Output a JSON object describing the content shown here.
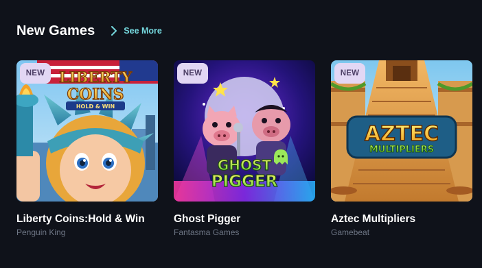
{
  "section": {
    "title": "New Games",
    "see_more": "See More",
    "see_more_icon": "chevron-right-icon"
  },
  "colors": {
    "background": "#0f121a",
    "accent": "#74d6dc",
    "badge_bg": "#e2d7f4",
    "badge_text": "#4d3f66",
    "provider_text": "#6e7685"
  },
  "games": [
    {
      "badge": "NEW",
      "art_title": "LIBERTY",
      "art_subtitle": "COINS",
      "art_tagline": "HOLD & WIN",
      "title": "Liberty Coins:Hold & Win",
      "provider": "Penguin King"
    },
    {
      "badge": "NEW",
      "art_title": "GHOST",
      "art_subtitle": "PIGGER",
      "title": "Ghost Pigger",
      "provider": "Fantasma Games"
    },
    {
      "badge": "NEW",
      "art_title": "AZTEC",
      "art_subtitle": "MULTIPLIERS",
      "title": "Aztec Multipliers",
      "provider": "Gamebeat"
    }
  ]
}
